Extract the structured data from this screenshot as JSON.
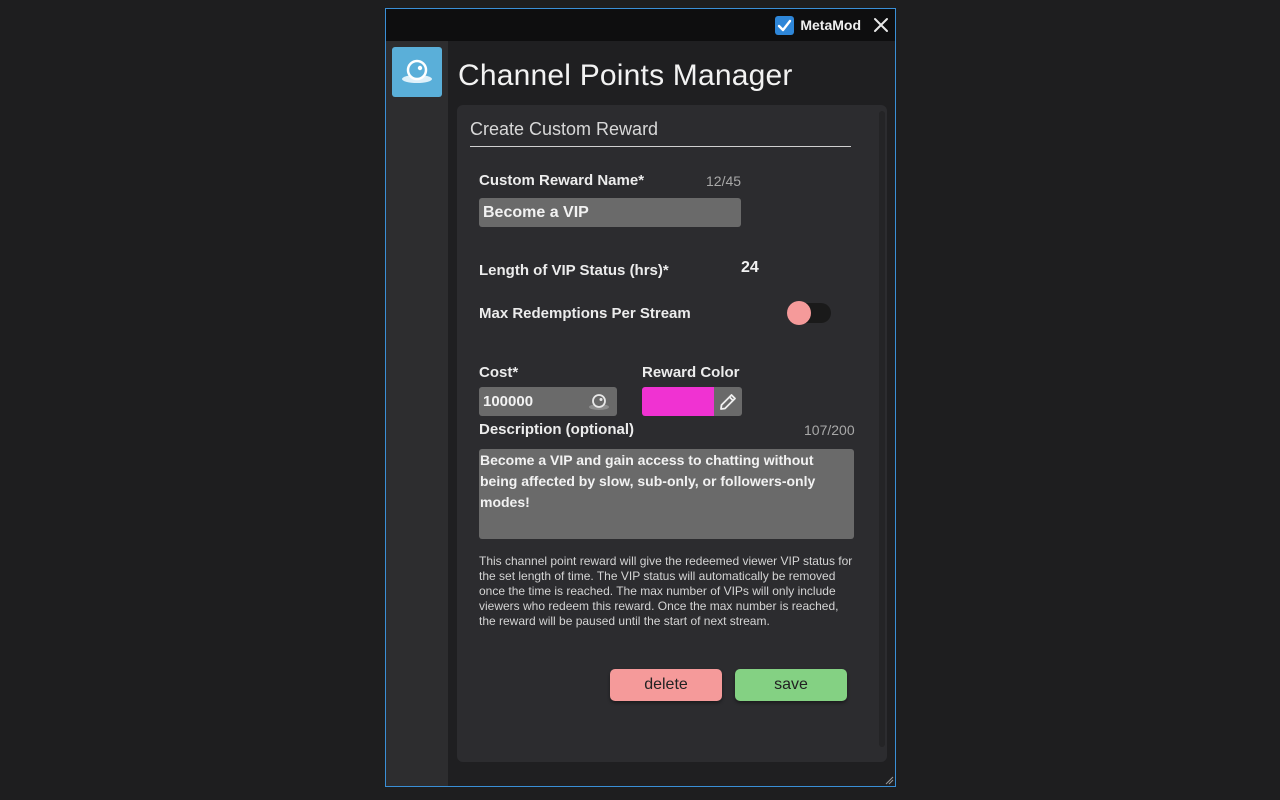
{
  "app": {
    "brand_name": "MetaMod",
    "page_title": "Channel Points Manager"
  },
  "form": {
    "section_title": "Create Custom Reward",
    "reward_name": {
      "label": "Custom Reward Name*",
      "counter": "12/45",
      "value": "Become a VIP"
    },
    "vip_length": {
      "label": "Length of VIP Status (hrs)*",
      "value": "24"
    },
    "max_redemptions": {
      "label": "Max Redemptions Per Stream",
      "enabled": false
    },
    "cost": {
      "label": "Cost*",
      "value": "100000"
    },
    "reward_color": {
      "label": "Reward Color",
      "value": "#f032d2"
    },
    "description": {
      "label": "Description (optional)",
      "counter": "107/200",
      "value": "Become a VIP and gain access to chatting without being affected by slow, sub-only, or followers-only modes!"
    },
    "help_text": "This channel point reward will give the redeemed viewer VIP status for the set length of time. The VIP status will automatically be removed once the time is reached. The max number of VIPs will only include viewers who redeem this reward. Once the max number is reached, the reward will be paused until the start of next stream.",
    "delete_label": "delete",
    "save_label": "save"
  },
  "icons": {
    "brand": "check-icon",
    "close": "close-icon",
    "sidebar_app": "channel-points-icon",
    "cost": "channel-points-icon",
    "color_edit": "pencil-icon"
  },
  "colors": {
    "accent": "#3a8fd6",
    "delete": "#f59a9a",
    "save": "#84d183",
    "toggle_knob": "#f59a9a"
  }
}
